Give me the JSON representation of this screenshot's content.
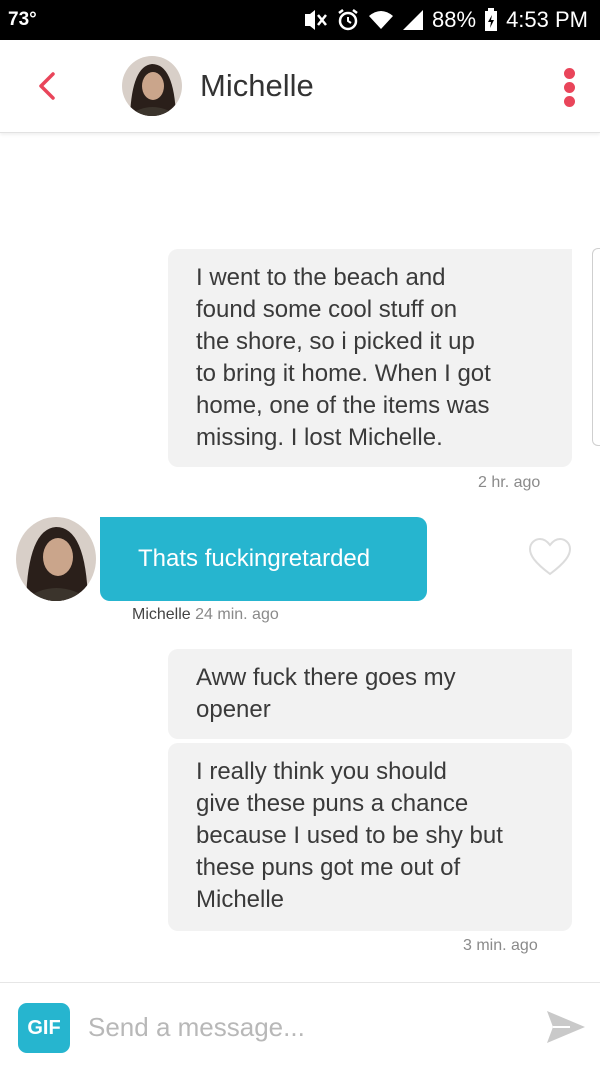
{
  "status_bar": {
    "temperature": "73°",
    "battery": "88%",
    "time": "4:53 PM"
  },
  "header": {
    "contact_name": "Michelle"
  },
  "messages": [
    {
      "direction": "outgoing",
      "text_lines": [
        "I went to the beach and",
        "found some cool stuff on",
        "the shore, so i picked it up",
        "to bring it home. When I got",
        "home, one of the items was",
        "missing. I lost Michelle."
      ]
    },
    {
      "direction": "outgoing",
      "timestamp": "2 hr. ago"
    },
    {
      "direction": "incoming",
      "sender": "Michelle",
      "text": "Thats fuckingretarded",
      "timestamp": "24 min. ago"
    },
    {
      "direction": "outgoing",
      "text_lines": [
        "Aww fuck there goes my",
        "opener"
      ]
    },
    {
      "direction": "outgoing",
      "text_lines": [
        "I really think you should",
        "give these puns a chance",
        "because I used to be shy but",
        "these puns got me out of",
        "Michelle"
      ],
      "timestamp": "3 min. ago"
    }
  ],
  "composer": {
    "gif_label": "GIF",
    "placeholder": "Send a message..."
  },
  "colors": {
    "accent_red": "#e9455a",
    "bubble_blue": "#26b5cf",
    "bubble_gray": "#f2f2f2"
  },
  "icons": {
    "back": "chevron-left-icon",
    "menu": "kebab-menu-icon",
    "like": "heart-outline-icon",
    "send": "send-arrow-icon"
  }
}
